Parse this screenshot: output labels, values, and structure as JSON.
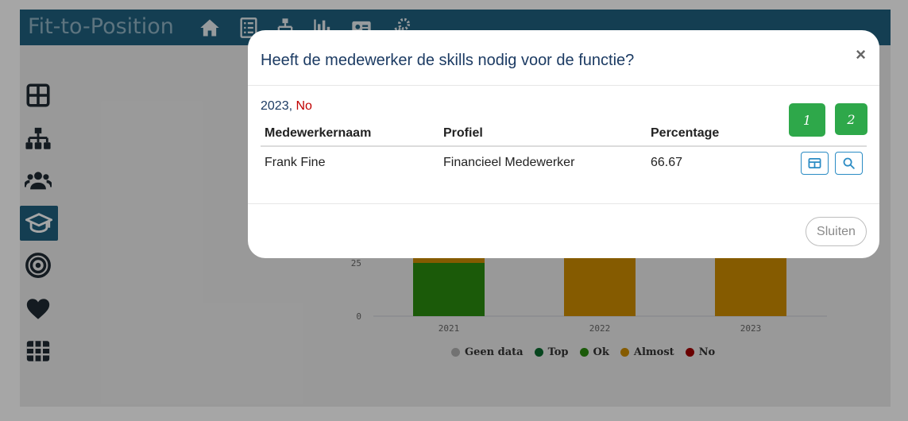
{
  "app": {
    "title": "Fit-to-Position"
  },
  "topnav": [
    {
      "icon": "home-icon"
    },
    {
      "icon": "checklist-icon"
    },
    {
      "icon": "org-chart-icon"
    },
    {
      "icon": "bar-chart-icon"
    },
    {
      "icon": "id-card-icon"
    },
    {
      "icon": "gears-icon"
    }
  ],
  "sidebar": [
    {
      "icon": "dashboard-icon",
      "active": false
    },
    {
      "icon": "hierarchy-icon",
      "active": false
    },
    {
      "icon": "users-icon",
      "active": false
    },
    {
      "icon": "graduation-cap-icon",
      "active": true
    },
    {
      "icon": "target-icon",
      "active": false
    },
    {
      "icon": "heart-icon",
      "active": false
    },
    {
      "icon": "grid-icon",
      "active": false
    }
  ],
  "colors": {
    "brand": "#20607f",
    "top": "#0b6b2e",
    "ok": "#2a8a0e",
    "almost": "#cc8c00",
    "no": "#a30000",
    "geen_data": "#b0b0b0",
    "pager": "#2ea84a"
  },
  "chart_data": {
    "type": "bar",
    "stacked": true,
    "categories": [
      "2021",
      "2022",
      "2023"
    ],
    "series": [
      {
        "name": "Geen data",
        "values": [
          0,
          0,
          0
        ]
      },
      {
        "name": "Top",
        "values": [
          0,
          0,
          0
        ]
      },
      {
        "name": "Ok",
        "values": [
          25,
          0,
          0
        ]
      },
      {
        "name": "Almost",
        "values": [
          9,
          100,
          96
        ]
      },
      {
        "name": "No",
        "values": [
          0,
          0,
          4
        ]
      }
    ],
    "y_ticks_visible": [
      "0",
      "25"
    ],
    "ylim": [
      0,
      100
    ],
    "legend": "bottom"
  },
  "modal": {
    "title": "Heeft de medewerker de skills nodig voor de functie?",
    "close": "×",
    "subtitle_year": "2023",
    "subtitle_sep": ", ",
    "subtitle_status": "No",
    "pagination": [
      "1",
      "2"
    ],
    "columns": [
      "Medewerkernaam",
      "Profiel",
      "Percentage"
    ],
    "rows": [
      {
        "name": "Frank Fine",
        "profile": "Financieel Medewerker",
        "percentage": "66.67"
      }
    ],
    "close_button": "Sluiten"
  }
}
